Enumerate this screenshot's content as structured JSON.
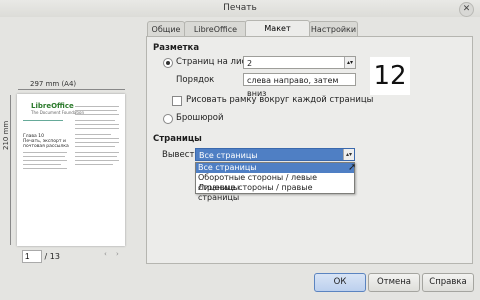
{
  "window": {
    "title": "Печать"
  },
  "preview": {
    "paper_size": "297 mm (A4)",
    "paper_height": "210 mm",
    "page_current": "1",
    "page_total": "/ 13",
    "logo_text": "LibreOffice",
    "logo_sub": "The Document Foundation",
    "chapter": [
      "Глава 10",
      "Печать, экспорт и",
      "почтовая рассылка"
    ]
  },
  "tabs": [
    {
      "label": "Общие"
    },
    {
      "label": "LibreOffice Writer"
    },
    {
      "label": "Макет страницы"
    },
    {
      "label": "Настройки"
    }
  ],
  "layout": {
    "section_title": "Разметка",
    "pages_per_sheet_label": "Страниц на лист",
    "pages_per_sheet_value": "2",
    "order_label": "Порядок",
    "order_value": "слева направо, затем вниз",
    "border_label": "Рисовать рамку вокруг каждой страницы",
    "brochure_label": "Брошюрой",
    "preview_number": "12"
  },
  "pages": {
    "section_title": "Страницы",
    "output_label": "Вывести",
    "output_value": "Все страницы",
    "options": [
      "Все страницы",
      "Оборотные стороны / левые страницы",
      "Лицевые стороны / правые страницы"
    ]
  },
  "buttons": {
    "ok": "ОК",
    "cancel": "Отмена",
    "help": "Справка"
  },
  "colors": {
    "selection": "#4f7fc4"
  }
}
